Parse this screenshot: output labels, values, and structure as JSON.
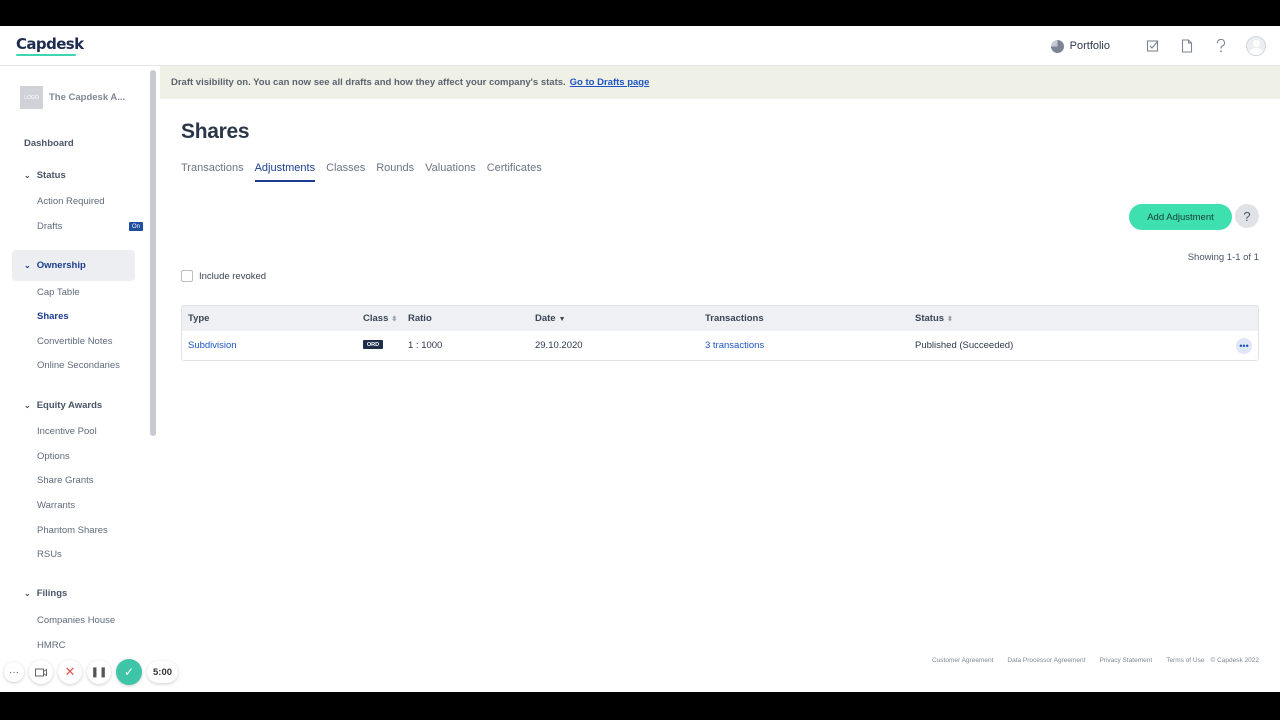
{
  "app": {
    "logo": "Capdesk"
  },
  "topbar": {
    "portfolio_label": "Portfolio",
    "icons": [
      "pie-chart-icon",
      "checklist-icon",
      "document-icon",
      "help-icon",
      "user-avatar"
    ]
  },
  "sidebar": {
    "company_logo_text": "LOGO",
    "company_name": "The Capdesk A...",
    "dashboard": "Dashboard",
    "status": {
      "title": "Status",
      "items": [
        "Action Required",
        "Drafts"
      ],
      "drafts_badge": "On"
    },
    "ownership": {
      "title": "Ownership",
      "items": [
        "Cap Table",
        "Shares",
        "Convertible Notes",
        "Online Secondaries"
      ],
      "active_item": "Shares"
    },
    "equity_awards": {
      "title": "Equity Awards",
      "items": [
        "Incentive Pool",
        "Options",
        "Share Grants",
        "Warrants",
        "Phantom Shares",
        "RSUs"
      ]
    },
    "filings": {
      "title": "Filings",
      "items": [
        "Companies House",
        "HMRC"
      ]
    }
  },
  "banner": {
    "text": "Draft visibility on. You can now see all drafts and how they affect your company's stats.",
    "link": "Go to Drafts page"
  },
  "page": {
    "title": "Shares",
    "tabs": [
      "Transactions",
      "Adjustments",
      "Classes",
      "Rounds",
      "Valuations",
      "Certificates"
    ],
    "active_tab": "Adjustments",
    "add_button": "Add Adjustment",
    "help_button": "?",
    "showing": "Showing 1-1 of 1",
    "include_revoked": "Include revoked"
  },
  "table": {
    "headers": [
      "Type",
      "Class",
      "Ratio",
      "Date",
      "Transactions",
      "Status"
    ],
    "rows": [
      {
        "type": "Subdivision",
        "class": "ORD",
        "ratio": "1 : 1000",
        "date": "29.10.2020",
        "transactions": "3 transactions",
        "status": "Published (Succeeded)",
        "menu": "•••"
      }
    ]
  },
  "footer": {
    "links": [
      "Customer Agreement",
      "Data Processor Agreement",
      "Privacy Statement",
      "Terms of Use"
    ],
    "copyright": "© Capdesk 2022"
  },
  "recorder": {
    "time": "5:00"
  },
  "colors": {
    "accent": "#3de0ae",
    "primary": "#1a3d8f",
    "link": "#1d53c4",
    "banner_bg": "#f0f1e6"
  }
}
